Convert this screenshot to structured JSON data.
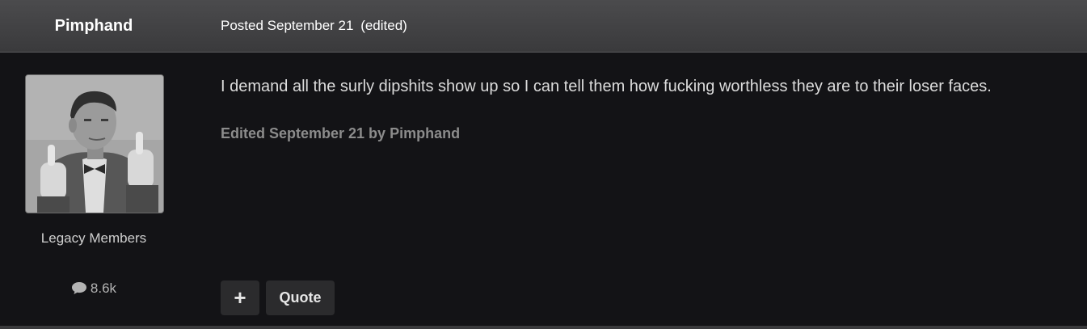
{
  "post": {
    "author": "Pimphand",
    "posted": "Posted September 21",
    "posted_edited": "(edited)",
    "body": "I demand all the surly dipshits show up so I can tell them how fucking worthless they are to their loser faces.",
    "edit_note": "Edited September 21 by Pimphand"
  },
  "author_panel": {
    "group": "Legacy Members",
    "post_count": "8.6k",
    "post_count_icon": "comment-icon"
  },
  "actions": {
    "plus_label": "+",
    "quote_label": "Quote"
  },
  "colors": {
    "header_bg": "#414143",
    "page_bg": "#131316",
    "body_text": "#dcdcdc",
    "muted_text": "#8c8c8c",
    "button_bg": "#2b2b2d"
  }
}
